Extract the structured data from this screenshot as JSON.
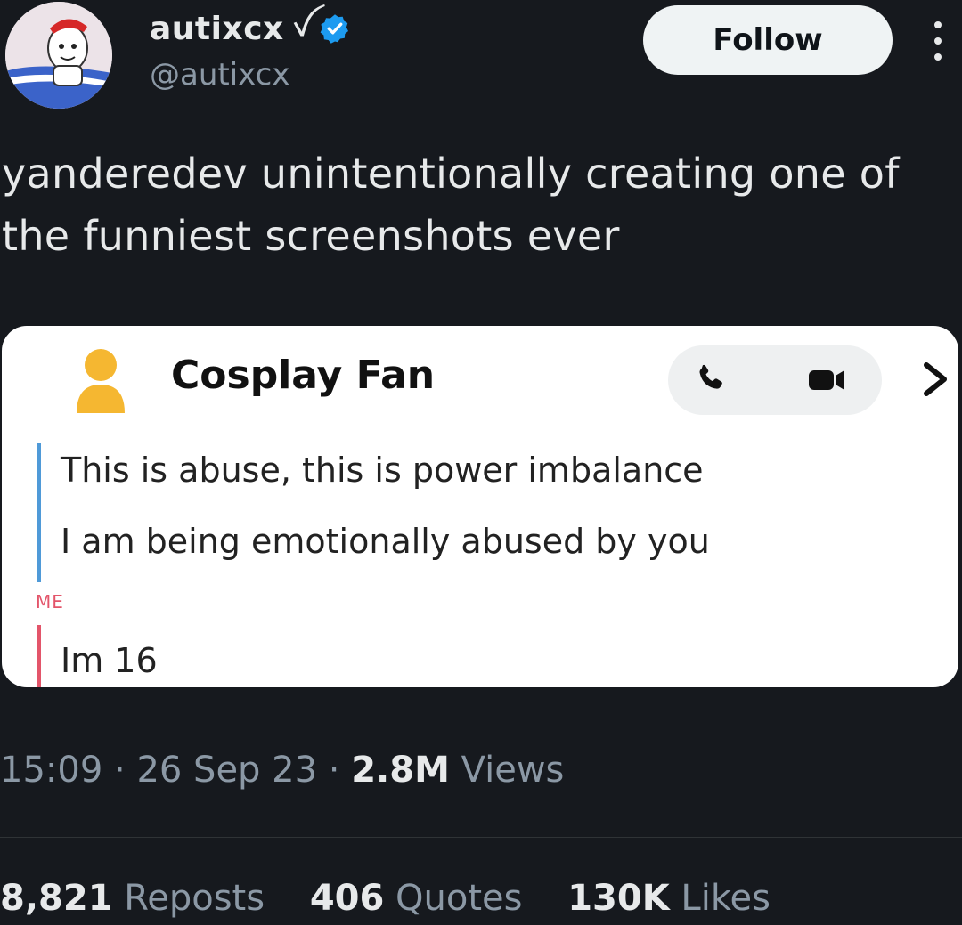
{
  "author": {
    "display_name": "autixcx",
    "name_emoji": "ꪜ",
    "handle": "@autixcx",
    "verified": true,
    "verified_color": "#1d9bf0"
  },
  "header": {
    "follow_label": "Follow"
  },
  "tweet": {
    "text": "yanderedev unintentionally creating one of the funniest screenshots ever"
  },
  "chat": {
    "contact_name": "Cosplay Fan",
    "messages": [
      "This is abuse, this is power imbalance",
      "I am being emotionally abused by you"
    ],
    "me_label": "ME",
    "reply": "Im 16",
    "colors": {
      "incoming_bar": "#4f9ad8",
      "outgoing_bar": "#e3556a",
      "contact_icon": "#f5b731"
    }
  },
  "meta": {
    "time": "15:09",
    "date": "26 Sep 23",
    "separator": "·",
    "views_count": "2.8M",
    "views_label": "Views"
  },
  "stats": {
    "reposts_count": "8,821",
    "reposts_label": "Reposts",
    "quotes_count": "406",
    "quotes_label": "Quotes",
    "likes_count": "130K",
    "likes_label": "Likes"
  }
}
